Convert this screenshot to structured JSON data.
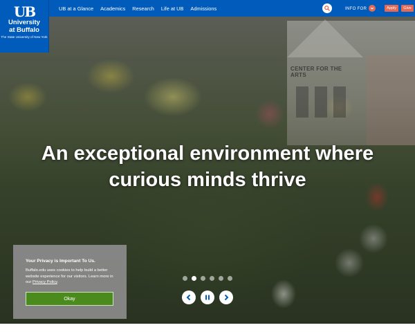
{
  "brand": {
    "mark": "UB",
    "line1": "University",
    "line2": "at Buffalo",
    "sub": "The State University of New York",
    "color": "#005bbb"
  },
  "nav": {
    "items": [
      {
        "label": "UB at a Glance"
      },
      {
        "label": "Academics"
      },
      {
        "label": "Research"
      },
      {
        "label": "Life at UB"
      },
      {
        "label": "Admissions"
      }
    ],
    "search_icon": "search-icon",
    "info_for": "INFO FOR",
    "apply": "Apply",
    "give": "Give",
    "accent": "#e56a54"
  },
  "hero": {
    "sign": "CENTER FOR THE ARTS",
    "headline_line1": "An exceptional environment where",
    "headline_line2": "curious minds thrive"
  },
  "carousel": {
    "slide_count": 6,
    "active_index": 1
  },
  "privacy": {
    "title": "Your Privacy is Important To Us.",
    "body": "Buffalo.edu uses cookies to help build a better website experience for our visitors. Learn more in our ",
    "link": "Privacy Policy",
    "period": ".",
    "button": "Okay",
    "button_color": "#4b8b1d"
  }
}
